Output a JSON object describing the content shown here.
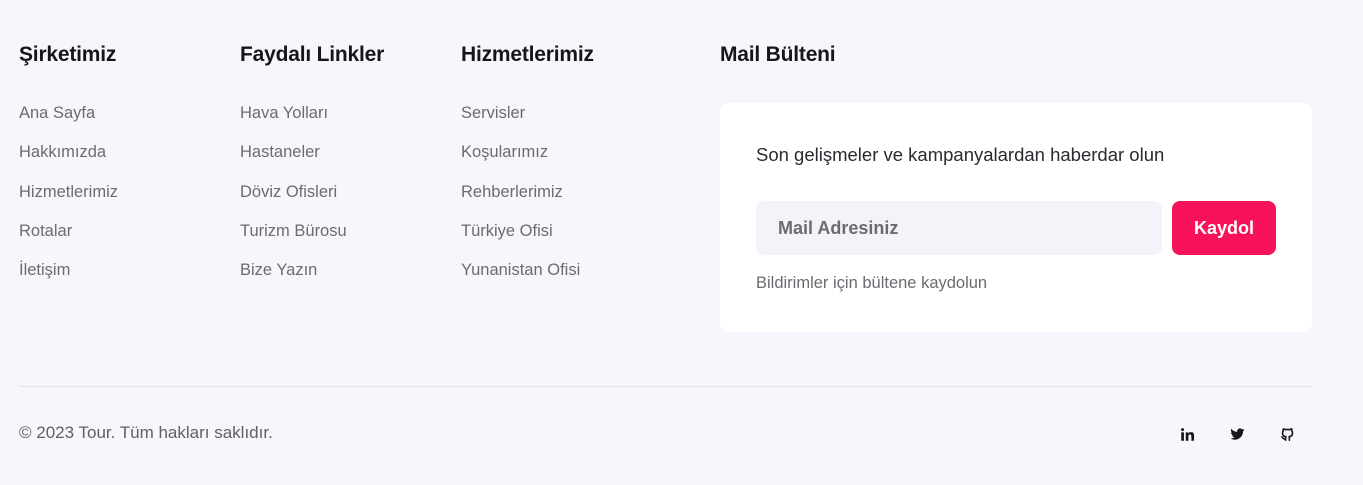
{
  "columns": [
    {
      "title": "Şirketimiz",
      "links": [
        "Ana Sayfa",
        "Hakkımızda",
        "Hizmetlerimiz",
        "Rotalar",
        "İletişim"
      ]
    },
    {
      "title": "Faydalı Linkler",
      "links": [
        "Hava Yolları",
        "Hastaneler",
        "Döviz Ofisleri",
        "Turizm Bürosu",
        "Bize Yazın"
      ]
    },
    {
      "title": "Hizmetlerimiz",
      "links": [
        "Servisler",
        "Koşularımız",
        "Rehberlerimiz",
        "Türkiye Ofisi",
        "Yunanistan Ofisi"
      ]
    }
  ],
  "newsletter": {
    "title": "Mail Bülteni",
    "lead": "Son gelişmeler ve kampanyalardan haberdar olun",
    "email_placeholder": "Mail Adresiniz",
    "email_value": "",
    "button_label": "Kaydol",
    "hint": "Bildirimler için bültene kaydolun"
  },
  "footer": {
    "copyright": "© 2023 Tour. Tüm hakları saklıdır.",
    "social": [
      {
        "name": "linkedin-icon"
      },
      {
        "name": "twitter-icon"
      },
      {
        "name": "github-icon"
      }
    ]
  },
  "colors": {
    "background": "#f7f6fc",
    "accent": "#f7125a",
    "card": "#ffffff",
    "muted_text": "#6b6b72"
  }
}
